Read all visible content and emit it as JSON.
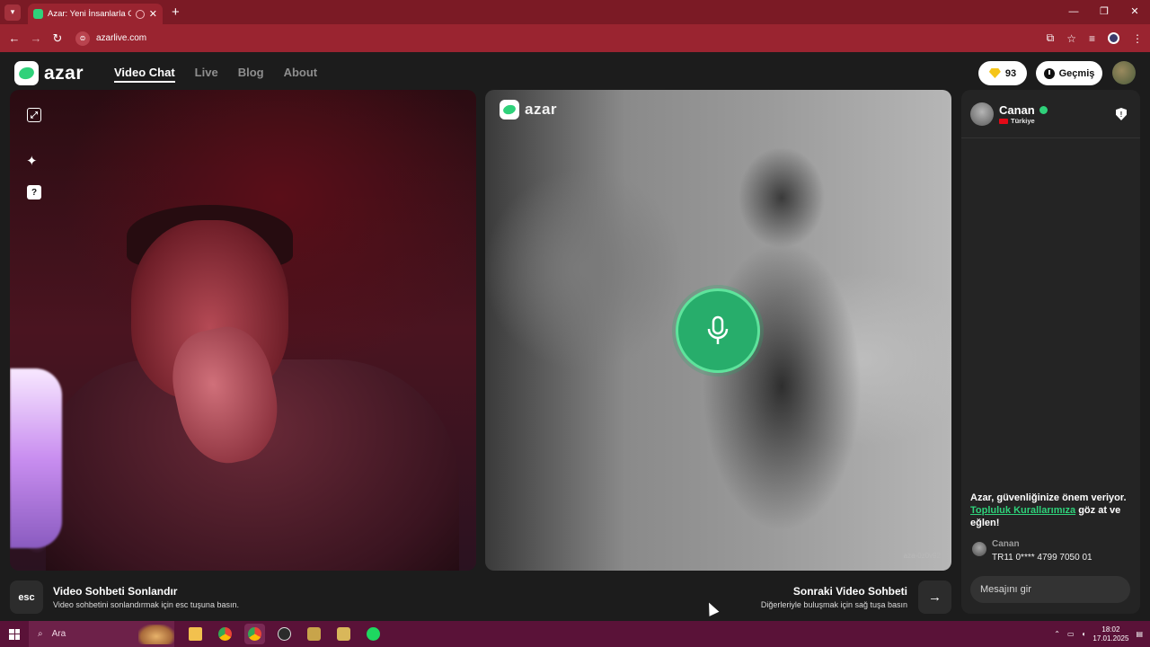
{
  "browser": {
    "tab_title": "Azar: Yeni İnsanlarla Görüntülü",
    "url": "azarlive.com",
    "window_controls": [
      "—",
      "❐",
      "✕"
    ]
  },
  "header": {
    "logo_text": "azar",
    "nav": [
      {
        "label": "Video Chat",
        "active": true
      },
      {
        "label": "Live",
        "active": false
      },
      {
        "label": "Blog",
        "active": false
      },
      {
        "label": "About",
        "active": false
      }
    ],
    "gems": "93",
    "history_label": "Geçmiş"
  },
  "left_tools": {
    "help_glyph": "?"
  },
  "remote": {
    "logo_text": "azar",
    "watermark_id": "aza-0z0v92"
  },
  "controls": {
    "esc_label": "esc",
    "end_title": "Video Sohbeti Sonlandır",
    "end_sub": "Video sohbetini sonlandırmak için esc tuşuna basın.",
    "next_title": "Sonraki Video Sohbeti",
    "next_sub": "Diğerleriyle buluşmak için sağ tuşa basın",
    "next_arrow": "→"
  },
  "chat": {
    "partner_name": "Canan",
    "partner_country": "Türkiye",
    "shield_glyph": "!",
    "safety_line1": "Azar, güvenliğinize önem veriyor.",
    "safety_link": "Topluluk Kurallarımıza",
    "safety_line2": " göz at ve eğlen!",
    "message_sender": "Canan",
    "message_text": "TR11 0**** 4799 7050 01",
    "input_placeholder": "Mesajını gir"
  },
  "taskbar": {
    "search_placeholder": "Ara",
    "time": "18:02",
    "date": "17.01.2025"
  },
  "colors": {
    "accent": "#2fd17a",
    "mic_button": "#27ad6b",
    "browser_frame": "#7b1a25",
    "taskbar": "#5a1238"
  }
}
